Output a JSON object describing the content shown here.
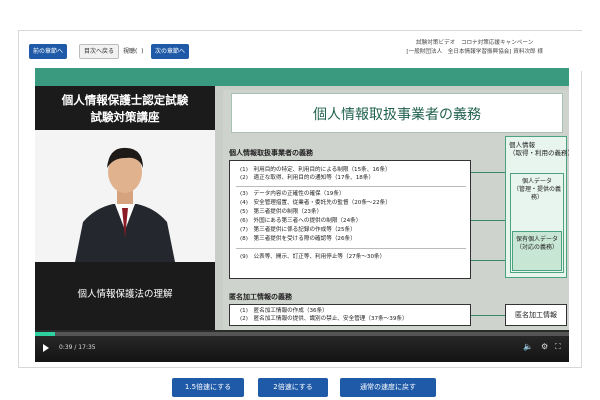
{
  "toolbar": {
    "prev_chapter": "前の章節へ",
    "chapter_list": "目次へ戻る",
    "viewed_label": "視聴(",
    "next_chapter": "次の章節へ"
  },
  "header": {
    "line1": "試験対策ビデオ　コロナ対策応援キャンペーン",
    "line2": "[一般財団法人　全日本情報学習振興協会] 資料次郎 様"
  },
  "course": {
    "title_line1": "個人情報保護士認定試験",
    "title_line2": "試験対策講座",
    "topic": "個人情報保護法の理解"
  },
  "slide": {
    "title": "個人情報取扱事業者の義務",
    "duty_section": "個人情報取扱事業者の義務",
    "duty_items": [
      "(1)　利用目的の特定、利用目的による制限（15条、16条）",
      "(2)　適正な取得、利用目的の通知等（17条、18条）",
      "(3)　データ内容の正確性の確保（19条）",
      "(4)　安全管理措置、従業者・委託先の監督（20条〜22条）",
      "(5)　第三者提供の制限（23条）",
      "(6)　外国にある第三者への提供の制限（24条）",
      "(7)　第三者提供に係る記録の作成等（25条）",
      "(8)　第三者提供を受ける際の確認等（26条）",
      "(9)　公表等、開示、訂正等、利用停止等（27条〜30条）"
    ],
    "right_title_line1": "個人情報",
    "right_title_line2": "（取得・利用の義務）",
    "personal_data_line1": "個人データ",
    "personal_data_line2": "（管理・提供の義務）",
    "retained_line1": "保有個人データ",
    "retained_line2": "（対応の義務）",
    "anon_section": "匿名加工情報の義務",
    "anon_items": [
      "(1)　匿名加工情報の作成（36条）",
      "(2)　匿名加工情報の提供、識別の禁止、安全管理（37条〜39条）"
    ],
    "anon_right": "匿名加工情報"
  },
  "player": {
    "time": "0:39 / 17:35",
    "progress": 0.038
  },
  "speed_buttons": {
    "speed_15": "1.5倍速にする",
    "speed_2": "2倍速にする",
    "speed_normal": "通常の速度に戻す"
  },
  "colors": {
    "accent_blue": "#1e5aa8",
    "brand_green": "#3a9a80",
    "progress_green": "#2ed0a0"
  }
}
